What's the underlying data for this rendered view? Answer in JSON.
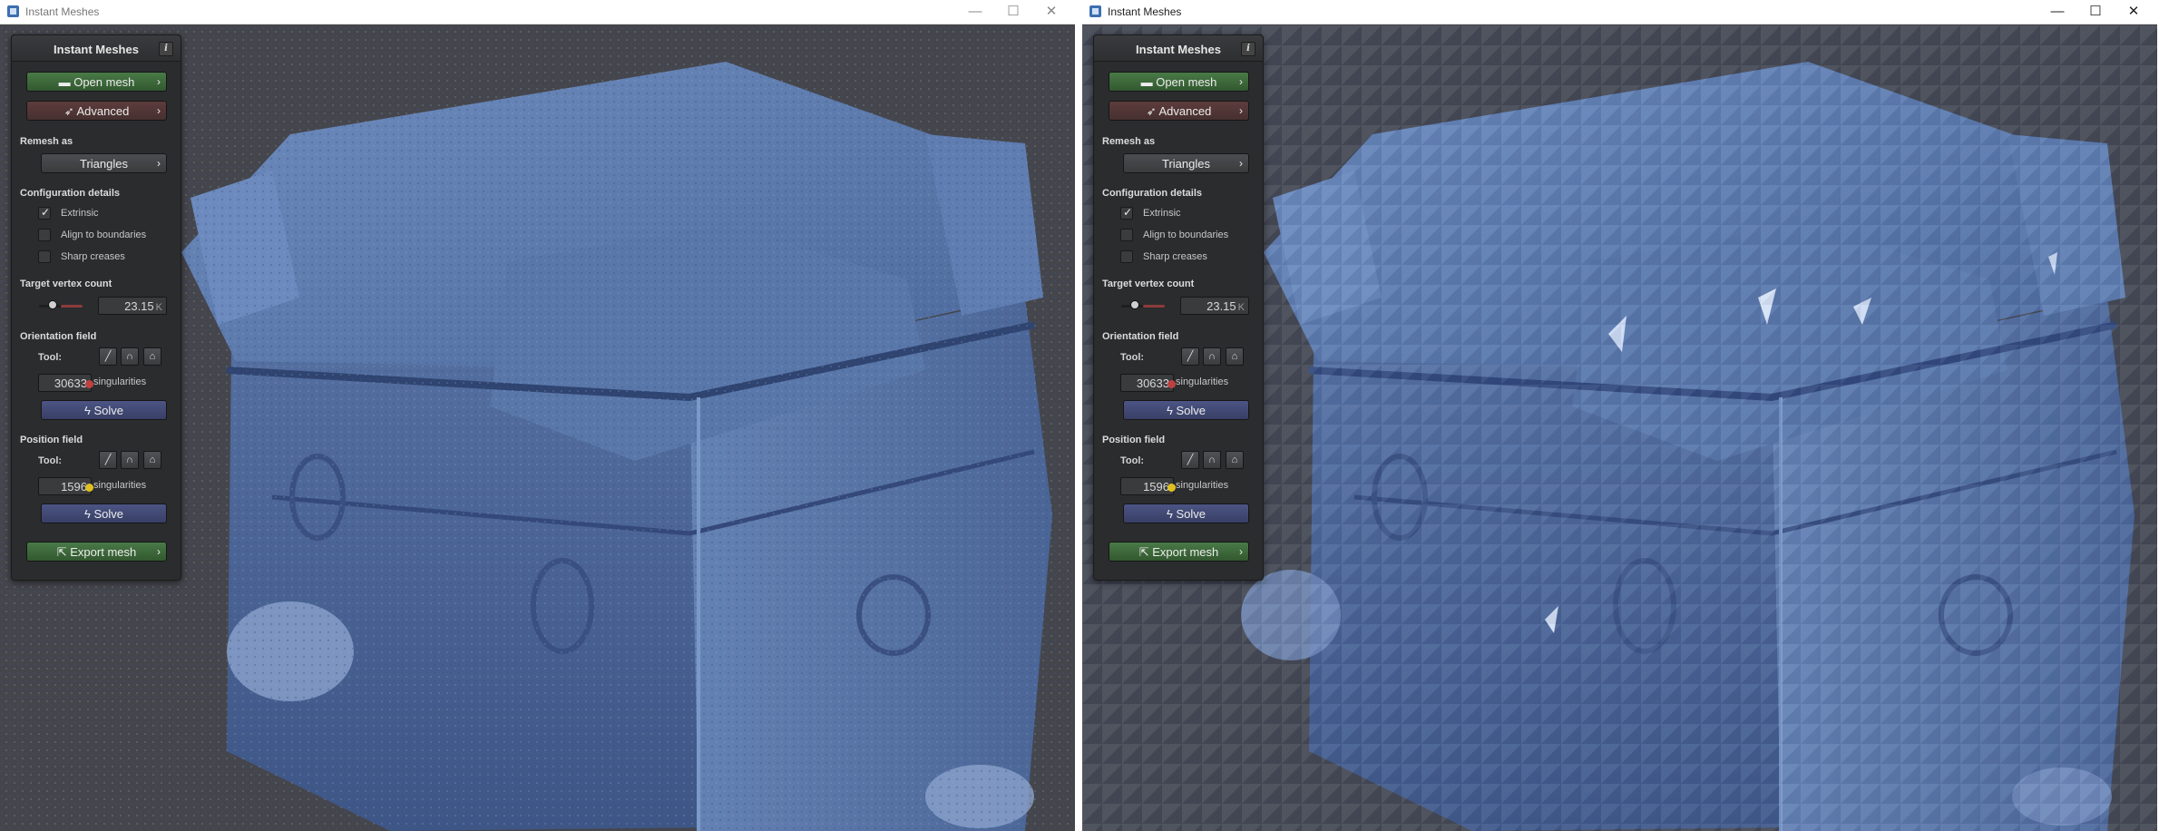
{
  "windows": [
    {
      "title": "Instant Meshes",
      "panel": {
        "title": "Instant Meshes",
        "info_icon": "i",
        "open_mesh": "Open mesh",
        "advanced": "Advanced",
        "remesh_as_label": "Remesh as",
        "remesh_as_value": "Triangles",
        "config_label": "Configuration details",
        "extrinsic": "Extrinsic",
        "extrinsic_checked": true,
        "align_boundaries": "Align to boundaries",
        "sharp_creases": "Sharp creases",
        "target_label": "Target vertex count",
        "target_value": "23.15",
        "target_unit": "K",
        "orientation_label": "Orientation field",
        "tool_label": "Tool:",
        "orient_singularities": "30633",
        "singularities_label": "singularities",
        "solve": "Solve",
        "position_label": "Position field",
        "pos_tool_label": "Tool:",
        "pos_singularities": "1596",
        "pos_singularities_label": "singularities",
        "pos_solve": "Solve",
        "export_mesh": "Export mesh"
      }
    },
    {
      "title": "Instant Meshes",
      "panel": {
        "title": "Instant Meshes",
        "info_icon": "i",
        "open_mesh": "Open mesh",
        "advanced": "Advanced",
        "remesh_as_label": "Remesh as",
        "remesh_as_value": "Triangles",
        "config_label": "Configuration details",
        "extrinsic": "Extrinsic",
        "extrinsic_checked": true,
        "align_boundaries": "Align to boundaries",
        "sharp_creases": "Sharp creases",
        "target_label": "Target vertex count",
        "target_value": "23.15",
        "target_unit": "K",
        "orientation_label": "Orientation field",
        "tool_label": "Tool:",
        "orient_singularities": "30633",
        "singularities_label": "singularities",
        "solve": "Solve",
        "position_label": "Position field",
        "pos_tool_label": "Tool:",
        "pos_singularities": "1596",
        "pos_singularities_label": "singularities",
        "pos_solve": "Solve",
        "export_mesh": "Export mesh"
      }
    }
  ],
  "titlebar_buttons": {
    "minimize": "—",
    "maximize": "☐",
    "close": "✕"
  },
  "icons": {
    "open_mesh": "folder-icon",
    "advanced": "rocket-icon",
    "solve": "lightning-icon",
    "export": "export-icon",
    "tool_comb": "comb-tool-icon",
    "tool_attractor": "attractor-tool-icon",
    "tool_edge": "edge-brush-icon"
  },
  "colors": {
    "viewport_bg": "#45464c",
    "mesh": "#5b78aa",
    "panel_bg": "#2b2c2e",
    "green_button": "#3f6b3c",
    "red_button": "#553636",
    "blue_button": "#434b78",
    "orientation_singularity": "#c04040",
    "position_singularity": "#e0c020"
  }
}
